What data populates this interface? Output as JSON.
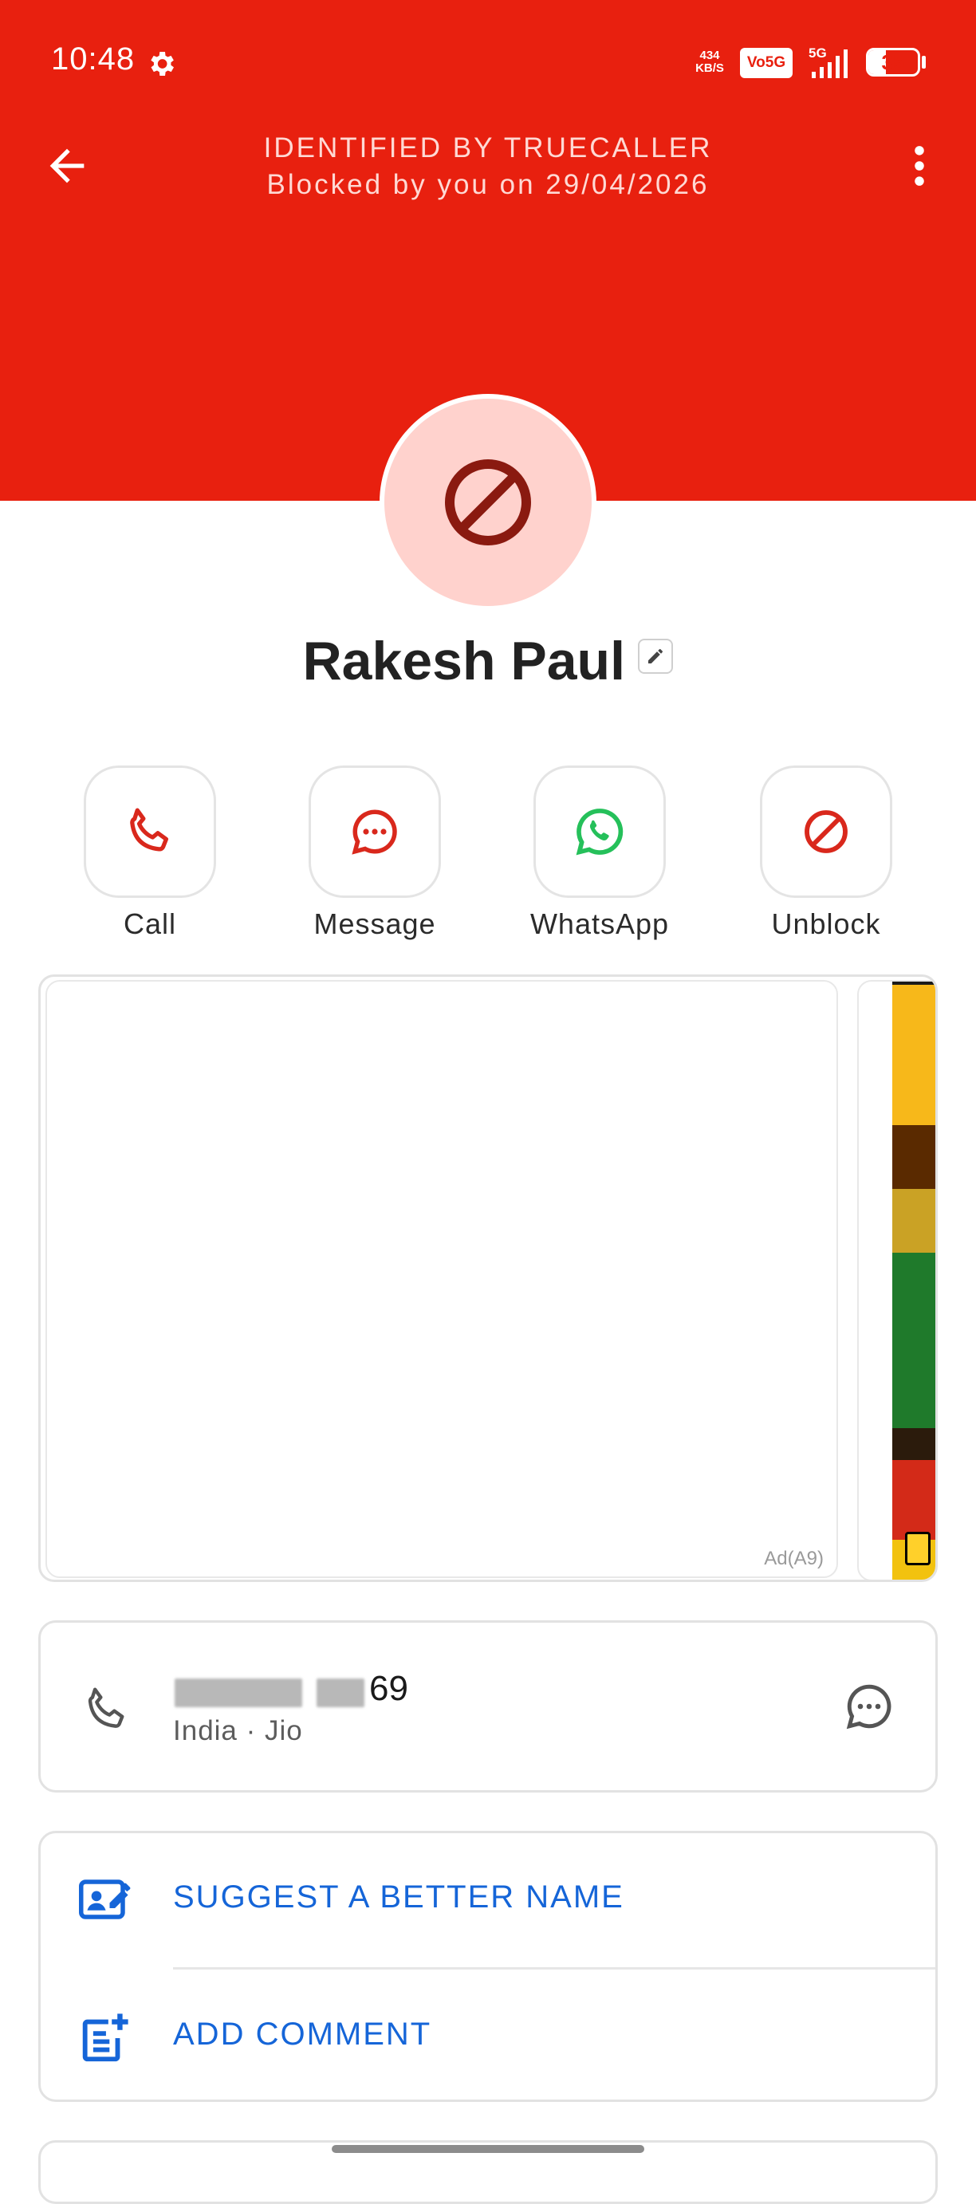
{
  "status_bar": {
    "time": "10:48",
    "speed_value": "434",
    "speed_unit": "KB/S",
    "network_badge": "Vo5G",
    "network_type": "5G",
    "battery": "35",
    "battery_level": 0.35
  },
  "header": {
    "title": "IDENTIFIED BY TRUECALLER",
    "subtitle": "Blocked by you on 29/04/2026",
    "background": "#e8200f"
  },
  "contact": {
    "name": "Rakesh Paul"
  },
  "actions": [
    {
      "label": "Call",
      "icon": "phone-icon",
      "color": "#d9281c"
    },
    {
      "label": "Message",
      "icon": "message-icon",
      "color": "#d9281c"
    },
    {
      "label": "WhatsApp",
      "icon": "whatsapp-icon",
      "color": "#25c05a"
    },
    {
      "label": "Unblock",
      "icon": "block-icon",
      "color": "#d9281c"
    }
  ],
  "ad": {
    "label": "Ad(A9)"
  },
  "number": {
    "visible_suffix": "69",
    "details": "India · Jio"
  },
  "options": {
    "suggest_name": "SUGGEST A BETTER NAME",
    "add_comment": "ADD COMMENT",
    "accent": "#1565d8"
  }
}
